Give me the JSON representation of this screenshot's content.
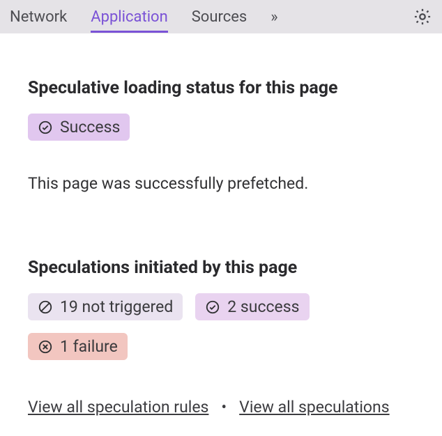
{
  "tabs": {
    "network": "Network",
    "application": "Application",
    "sources": "Sources"
  },
  "section1": {
    "title": "Speculative loading status for this page",
    "chip_success": "Success",
    "body": "This page was successfully prefetched."
  },
  "section2": {
    "title": "Speculations initiated by this page",
    "chip_not_triggered": "19 not triggered",
    "chip_success": "2 success",
    "chip_fail": "1 failure"
  },
  "links": {
    "rules": "View all speculation rules",
    "speculations": "View all speculations"
  }
}
